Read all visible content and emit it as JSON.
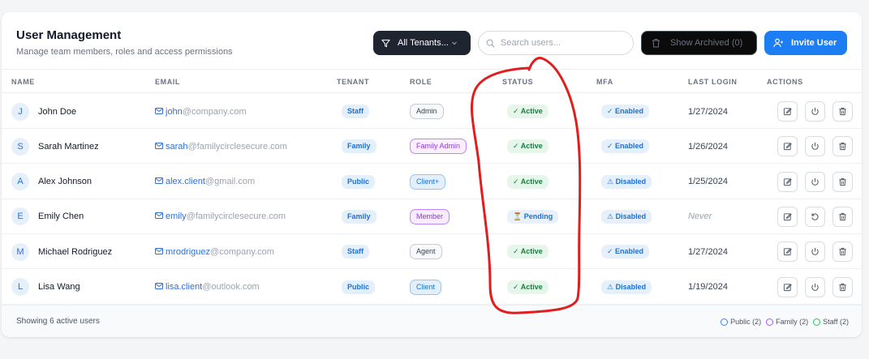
{
  "header": {
    "title": "User Management",
    "subtitle": "Manage team members, roles and access permissions",
    "tenant_filter_label": "All Tenants...",
    "search_placeholder": "Search users...",
    "archived_label": "Show Archived (0)",
    "invite_label": "Invite User"
  },
  "table": {
    "columns": [
      "NAME",
      "EMAIL",
      "TENANT",
      "ROLE",
      "STATUS",
      "MFA",
      "LAST LOGIN",
      "ACTIONS"
    ],
    "rows": [
      {
        "initial": "J",
        "name": "John Doe",
        "email_user": "john",
        "email_domain": "@company.com",
        "tenant": "Staff",
        "role": "Admin",
        "status": "✓ Active",
        "mfa": "✓ Enabled",
        "last_login": "1/27/2024"
      },
      {
        "initial": "S",
        "name": "Sarah Martinez",
        "email_user": "sarah",
        "email_domain": "@familycirclesecure.com",
        "tenant": "Family",
        "role": "Family Admin",
        "status": "✓ Active",
        "mfa": "✓ Enabled",
        "last_login": "1/26/2024"
      },
      {
        "initial": "A",
        "name": "Alex Johnson",
        "email_user": "alex.client",
        "email_domain": "@gmail.com",
        "tenant": "Public",
        "role": "Client+",
        "status": "✓ Active",
        "mfa": "⚠ Disabled",
        "last_login": "1/25/2024"
      },
      {
        "initial": "E",
        "name": "Emily Chen",
        "email_user": "emily",
        "email_domain": "@familycirclesecure.com",
        "tenant": "Family",
        "role": "Member",
        "status": "⏳ Pending",
        "mfa": "⚠ Disabled",
        "last_login": "Never"
      },
      {
        "initial": "M",
        "name": "Michael Rodriguez",
        "email_user": "mrodriguez",
        "email_domain": "@company.com",
        "tenant": "Staff",
        "role": "Agent",
        "status": "✓ Active",
        "mfa": "✓ Enabled",
        "last_login": "1/27/2024"
      },
      {
        "initial": "L",
        "name": "Lisa Wang",
        "email_user": "lisa.client",
        "email_domain": "@outlook.com",
        "tenant": "Public",
        "role": "Client",
        "status": "✓ Active",
        "mfa": "⚠ Disabled",
        "last_login": "1/19/2024"
      }
    ]
  },
  "footer": {
    "summary": "Showing 6 active users",
    "legend": [
      {
        "label": "Public (2)",
        "color": "#3b82f6"
      },
      {
        "label": "Family (2)",
        "color": "#a855f7"
      },
      {
        "label": "Staff (2)",
        "color": "#22c55e"
      }
    ]
  },
  "colors": {
    "accent": "#1d7ef3",
    "dark_button": "#1f2530",
    "annotation": "#e11d1d"
  }
}
